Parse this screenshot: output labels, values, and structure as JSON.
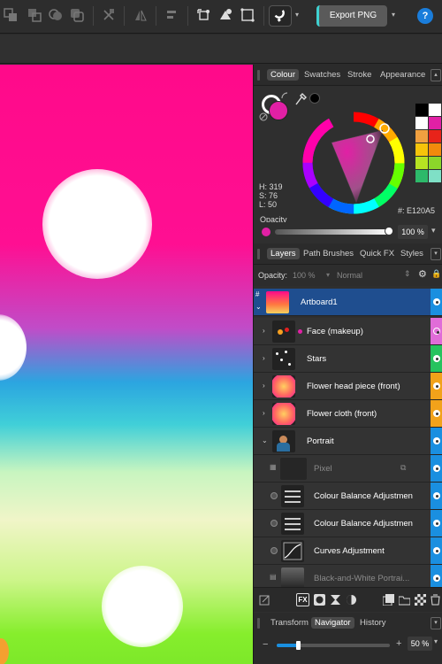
{
  "toolbar": {
    "export_label": "Export PNG",
    "help_label": "?"
  },
  "colour_panel": {
    "tabs": [
      "Colour",
      "Swatches",
      "Stroke",
      "Appearance"
    ],
    "active_tab": "Colour",
    "h_label": "H: 319",
    "s_label": "S: 76",
    "l_label": "L: 50",
    "hex_label": "#: E120A5",
    "opacity_label": "Opacity",
    "opacity_value": "100 %",
    "current_color": "#e120a5"
  },
  "layers_panel": {
    "tabs": [
      "Layers",
      "Path Brushes",
      "Quick FX",
      "Styles"
    ],
    "active_tab": "Layers",
    "opacity_label": "Opacity:",
    "opacity_value": "100 %",
    "blend_mode": "Normal",
    "layers": [
      {
        "name": "Artboard1",
        "selected": true,
        "tag_color": "#1a8fe0"
      },
      {
        "name": "Face (makeup)",
        "tag_color": "#e06cd8"
      },
      {
        "name": "Stars",
        "tag_color": "#26c35e"
      },
      {
        "name": "Flower head piece (front)",
        "tag_color": "#f2a21a"
      },
      {
        "name": "Flower cloth (front)",
        "tag_color": "#f2a21a"
      },
      {
        "name": "Portrait",
        "tag_color": "#1a8fe0"
      },
      {
        "name": "Pixel",
        "dim": true,
        "tag_color": "#1a8fe0"
      },
      {
        "name": "Colour Balance Adjustmen",
        "tag_color": "#1a8fe0"
      },
      {
        "name": "Colour Balance Adjustmen",
        "tag_color": "#1a8fe0"
      },
      {
        "name": "Curves Adjustment",
        "tag_color": "#1a8fe0"
      },
      {
        "name": "Black-and-White Portrai...",
        "dim": true,
        "tag_color": "#1a8fe0"
      }
    ]
  },
  "bottom_tabs": {
    "tabs": [
      "Transform",
      "Navigator",
      "History"
    ],
    "active_tab": "Navigator",
    "zoom_value": "50 %"
  }
}
